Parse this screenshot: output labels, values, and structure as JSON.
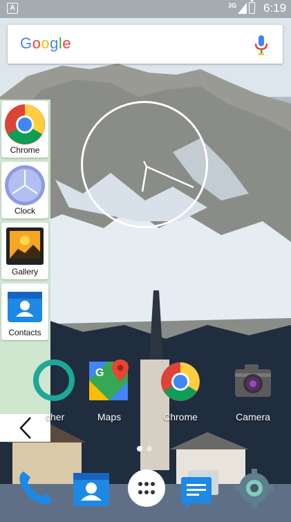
{
  "status_bar": {
    "notification_icon": "A",
    "network_type": "3G",
    "time": "6:19"
  },
  "search": {
    "logo_letters": [
      {
        "char": "G",
        "color": "#4285F4"
      },
      {
        "char": "o",
        "color": "#EA4335"
      },
      {
        "char": "o",
        "color": "#FBBC05"
      },
      {
        "char": "g",
        "color": "#4285F4"
      },
      {
        "char": "l",
        "color": "#34A853"
      },
      {
        "char": "e",
        "color": "#EA4335"
      }
    ],
    "mic_icon": "mic-icon"
  },
  "side_panel": {
    "items": [
      {
        "label": "Chrome",
        "icon": "chrome-icon"
      },
      {
        "label": "Clock",
        "icon": "clock-icon"
      },
      {
        "label": "Gallery",
        "icon": "gallery-icon"
      },
      {
        "label": "Contacts",
        "icon": "contacts-icon"
      }
    ],
    "back_icon": "chevron-left-icon",
    "background_color": "#cfe6cf"
  },
  "home_apps": [
    {
      "label": "cher",
      "icon": "launcher-icon"
    },
    {
      "label": "Maps",
      "icon": "maps-icon"
    },
    {
      "label": "Chrome",
      "icon": "chrome-icon"
    },
    {
      "label": "Camera",
      "icon": "camera-icon"
    }
  ],
  "page_indicator": {
    "pages": 2,
    "current": 1
  },
  "dock": [
    {
      "icon": "phone-icon"
    },
    {
      "icon": "contacts-icon"
    },
    {
      "icon": "app-drawer-icon"
    },
    {
      "icon": "messages-icon"
    },
    {
      "icon": "settings-icon"
    }
  ],
  "colors": {
    "google_blue": "#4285F4",
    "google_red": "#EA4335",
    "google_yellow": "#FBBC05",
    "google_green": "#34A853",
    "contacts_blue": "#1E88E5"
  }
}
